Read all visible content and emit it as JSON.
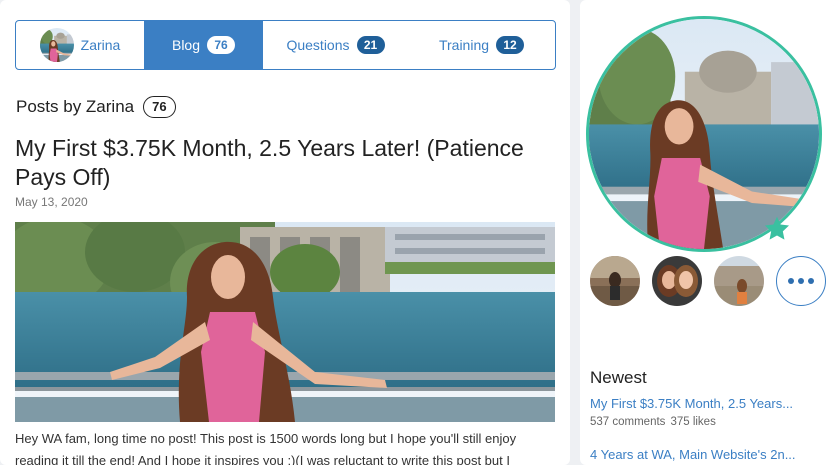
{
  "profile": {
    "username": "Zarina"
  },
  "tabs": {
    "blog": {
      "label": "Blog",
      "count": "76"
    },
    "questions": {
      "label": "Questions",
      "count": "21"
    },
    "training": {
      "label": "Training",
      "count": "12"
    }
  },
  "posts_header": {
    "label": "Posts by Zarina",
    "count": "76"
  },
  "post": {
    "title": "My First $3.75K Month, 2.5 Years Later! (Patience Pays Off)",
    "date": "May 13, 2020",
    "excerpt": "Hey WA fam, long time no post! This post is 1500 words long but I hope you'll still enjoy reading it till the end! And I hope it inspires you :)(I was reluctant to write this post but I"
  },
  "sidebar": {
    "newest_title": "Newest",
    "newest": [
      {
        "title": "My First $3.75K Month, 2.5 Years...",
        "comments": "537 comments",
        "likes": "375 likes"
      },
      {
        "title": "4 Years at WA, Main Website's 2n..."
      }
    ]
  },
  "colors": {
    "accent": "#3b7fc4",
    "badge_dark": "#1f5f99",
    "avatar_ring": "#3ac0a0"
  },
  "icons": [
    "star-icon",
    "more-dots-icon"
  ]
}
